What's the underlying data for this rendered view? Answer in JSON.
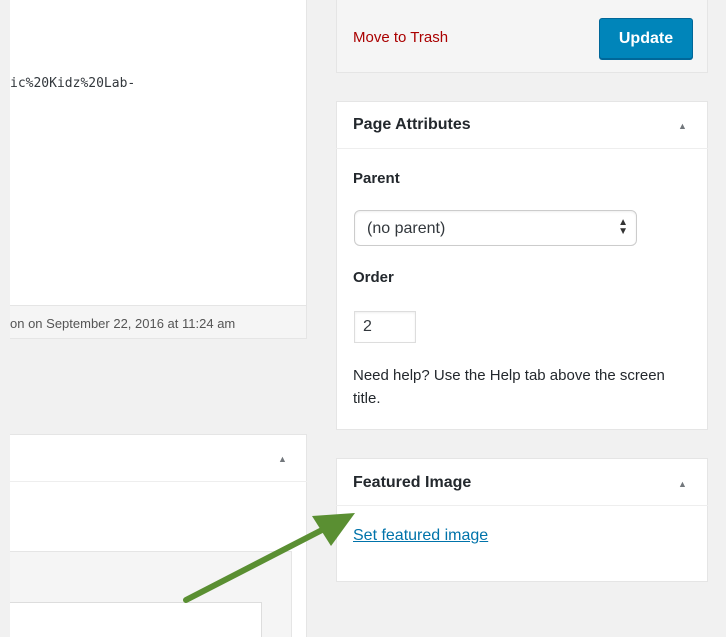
{
  "editor": {
    "permalink_fragment": "ic%20Kidz%20Lab-",
    "last_edited": "on on September 22, 2016 at 11:24 am",
    "toggle_icon": "triangle-up-icon"
  },
  "publish": {
    "trash_label": "Move to Trash",
    "update_label": "Update",
    "update_color": "#0085ba",
    "trash_color": "#aa0000"
  },
  "page_attributes": {
    "title": "Page Attributes",
    "parent_label": "Parent",
    "parent_value": "(no parent)",
    "order_label": "Order",
    "order_value": "2",
    "help_text": "Need help? Use the Help tab above the screen title."
  },
  "featured_image": {
    "title": "Featured Image",
    "link_label": "Set featured image",
    "link_color": "#0073aa"
  },
  "annotation": {
    "arrow_color": "#5a8f32",
    "arrow_icon": "green-pointer-arrow"
  }
}
